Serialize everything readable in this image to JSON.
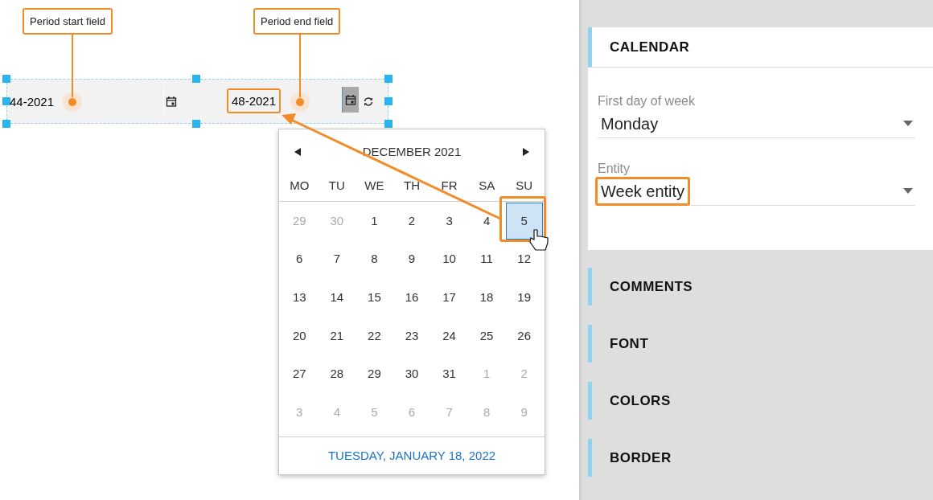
{
  "callouts": [
    {
      "label": "Period start field"
    },
    {
      "label": "Period end field"
    }
  ],
  "period_widget": {
    "start_value": "44-2021",
    "end_value": "48-2021",
    "end_highlighted": true
  },
  "calendar": {
    "month": "DECEMBER 2021",
    "highlight_selected": true,
    "weekdays": [
      "MO",
      "TU",
      "WE",
      "TH",
      "FR",
      "SA",
      "SU"
    ],
    "weeks": [
      [
        {
          "label": "29",
          "outside": true,
          "selected": false
        },
        {
          "label": "30",
          "outside": true,
          "selected": false
        },
        {
          "label": "1",
          "outside": false,
          "selected": false
        },
        {
          "label": "2",
          "outside": false,
          "selected": false
        },
        {
          "label": "3",
          "outside": false,
          "selected": false
        },
        {
          "label": "4",
          "outside": false,
          "selected": false
        },
        {
          "label": "5",
          "outside": false,
          "selected": true
        }
      ],
      [
        {
          "label": "6",
          "outside": false,
          "selected": false
        },
        {
          "label": "7",
          "outside": false,
          "selected": false
        },
        {
          "label": "8",
          "outside": false,
          "selected": false
        },
        {
          "label": "9",
          "outside": false,
          "selected": false
        },
        {
          "label": "10",
          "outside": false,
          "selected": false
        },
        {
          "label": "11",
          "outside": false,
          "selected": false
        },
        {
          "label": "12",
          "outside": false,
          "selected": false
        }
      ],
      [
        {
          "label": "13",
          "outside": false,
          "selected": false
        },
        {
          "label": "14",
          "outside": false,
          "selected": false
        },
        {
          "label": "15",
          "outside": false,
          "selected": false
        },
        {
          "label": "16",
          "outside": false,
          "selected": false
        },
        {
          "label": "17",
          "outside": false,
          "selected": false
        },
        {
          "label": "18",
          "outside": false,
          "selected": false
        },
        {
          "label": "19",
          "outside": false,
          "selected": false
        }
      ],
      [
        {
          "label": "20",
          "outside": false,
          "selected": false
        },
        {
          "label": "21",
          "outside": false,
          "selected": false
        },
        {
          "label": "22",
          "outside": false,
          "selected": false
        },
        {
          "label": "23",
          "outside": false,
          "selected": false
        },
        {
          "label": "24",
          "outside": false,
          "selected": false
        },
        {
          "label": "25",
          "outside": false,
          "selected": false
        },
        {
          "label": "26",
          "outside": false,
          "selected": false
        }
      ],
      [
        {
          "label": "27",
          "outside": false,
          "selected": false
        },
        {
          "label": "28",
          "outside": false,
          "selected": false
        },
        {
          "label": "29",
          "outside": false,
          "selected": false
        },
        {
          "label": "30",
          "outside": false,
          "selected": false
        },
        {
          "label": "31",
          "outside": false,
          "selected": false
        },
        {
          "label": "1",
          "outside": true,
          "selected": false
        },
        {
          "label": "2",
          "outside": true,
          "selected": false
        }
      ],
      [
        {
          "label": "3",
          "outside": true,
          "selected": false
        },
        {
          "label": "4",
          "outside": true,
          "selected": false
        },
        {
          "label": "5",
          "outside": true,
          "selected": false
        },
        {
          "label": "6",
          "outside": true,
          "selected": false
        },
        {
          "label": "7",
          "outside": true,
          "selected": false
        },
        {
          "label": "8",
          "outside": true,
          "selected": false
        },
        {
          "label": "9",
          "outside": true,
          "selected": false
        }
      ]
    ],
    "footer": "TUESDAY, JANUARY 18, 2022"
  },
  "panel": {
    "sections": [
      {
        "title": "CALENDAR",
        "expanded": true,
        "fields": [
          {
            "label": "First day of week",
            "value": "Monday",
            "highlighted": false
          },
          {
            "label": "Entity",
            "value": "Week entity",
            "highlighted": true
          }
        ]
      },
      {
        "title": "COMMENTS",
        "expanded": false
      },
      {
        "title": "FONT",
        "expanded": false
      },
      {
        "title": "COLORS",
        "expanded": false
      },
      {
        "title": "BORDER",
        "expanded": false
      }
    ]
  }
}
